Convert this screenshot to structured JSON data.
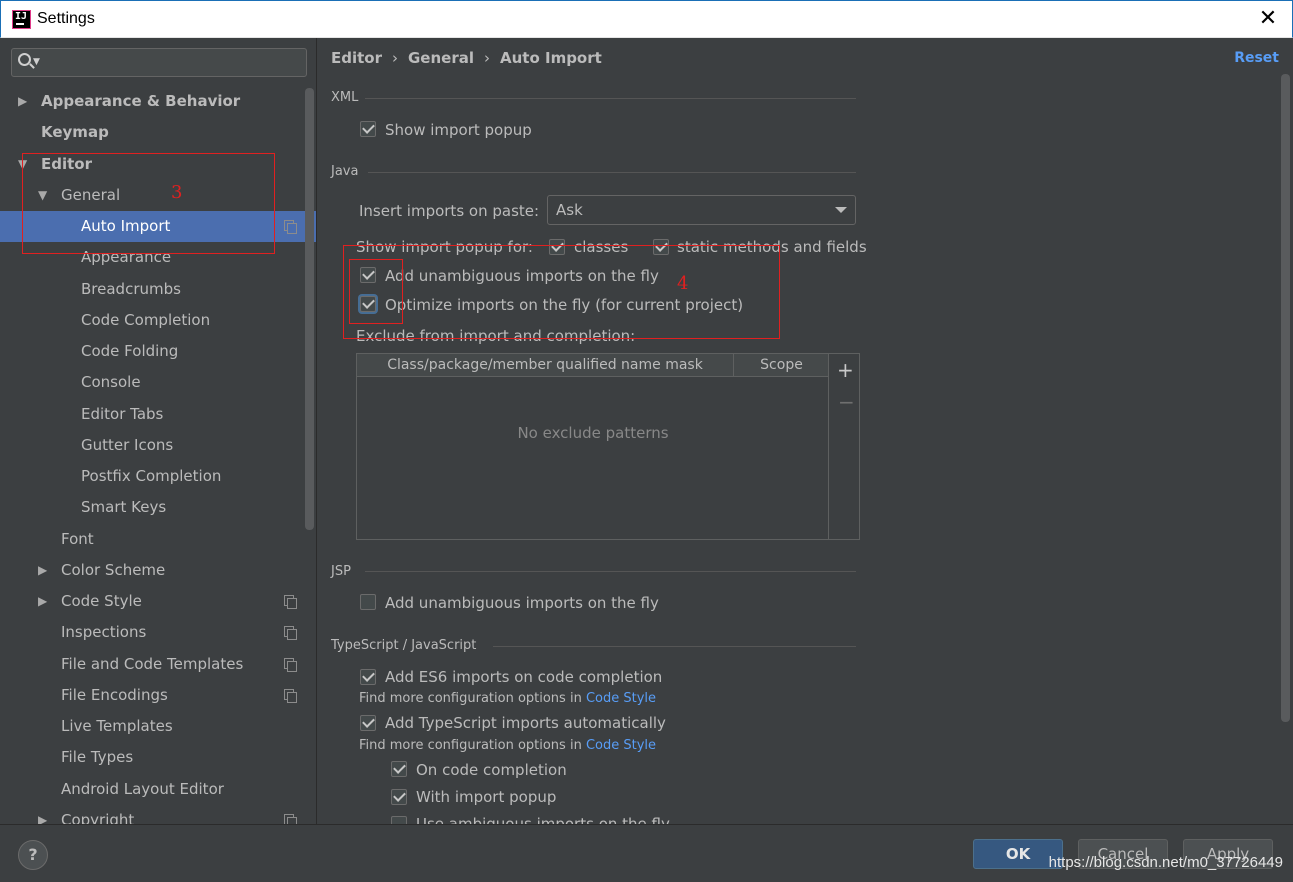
{
  "window": {
    "title": "Settings",
    "app_icon_text": "IJ"
  },
  "sidebar": {
    "search_value": "",
    "items": [
      {
        "label": "Appearance & Behavior"
      },
      {
        "label": "Keymap"
      },
      {
        "label": "Editor"
      },
      {
        "label": "General"
      },
      {
        "label": "Auto Import"
      },
      {
        "label": "Appearance"
      },
      {
        "label": "Breadcrumbs"
      },
      {
        "label": "Code Completion"
      },
      {
        "label": "Code Folding"
      },
      {
        "label": "Console"
      },
      {
        "label": "Editor Tabs"
      },
      {
        "label": "Gutter Icons"
      },
      {
        "label": "Postfix Completion"
      },
      {
        "label": "Smart Keys"
      },
      {
        "label": "Font"
      },
      {
        "label": "Color Scheme"
      },
      {
        "label": "Code Style"
      },
      {
        "label": "Inspections"
      },
      {
        "label": "File and Code Templates"
      },
      {
        "label": "File Encodings"
      },
      {
        "label": "Live Templates"
      },
      {
        "label": "File Types"
      },
      {
        "label": "Android Layout Editor"
      },
      {
        "label": "Copyright"
      }
    ]
  },
  "breadcrumb": {
    "p1": "Editor",
    "p2": "General",
    "p3": "Auto Import",
    "sep": "›"
  },
  "reset_label": "Reset",
  "xml": {
    "section": "XML",
    "show_import_popup": {
      "label": "Show import popup",
      "checked": true
    }
  },
  "java": {
    "section": "Java",
    "insert_on_paste_label": "Insert imports on paste:",
    "insert_on_paste_value": "Ask",
    "popup_for_label": "Show import popup for:",
    "classes": {
      "label": "classes",
      "checked": true
    },
    "static_methods": {
      "label": "static methods and fields",
      "checked": true
    },
    "add_unambiguous": {
      "label": "Add unambiguous imports on the fly",
      "checked": true
    },
    "optimize": {
      "label": "Optimize imports on the fly (for current project)",
      "checked": true
    },
    "exclude_label": "Exclude from import and completion:",
    "table": {
      "col1": "Class/package/member qualified name mask",
      "col2": "Scope",
      "empty": "No exclude patterns",
      "add": "+",
      "remove": "−"
    }
  },
  "jsp": {
    "section": "JSP",
    "add_unambiguous": {
      "label": "Add unambiguous imports on the fly",
      "checked": false
    }
  },
  "ts": {
    "section": "TypeScript / JavaScript",
    "es6": {
      "label": "Add ES6 imports on code completion",
      "checked": true
    },
    "note1": "Find more configuration options in",
    "link1": "Code Style",
    "ts_auto": {
      "label": "Add TypeScript imports automatically",
      "checked": true
    },
    "note2": "Find more configuration options in",
    "link2": "Code Style",
    "on_completion": {
      "label": "On code completion",
      "checked": true
    },
    "with_popup": {
      "label": "With import popup",
      "checked": true
    },
    "unambig_cut": {
      "label": "Use ambiguous imports on the fly",
      "checked": false
    }
  },
  "annotations": {
    "a3": "3",
    "a4": "4"
  },
  "footer": {
    "help": "?",
    "ok": "OK",
    "cancel": "Cancel",
    "apply": "Apply",
    "watermark": "https://blog.csdn.net/m0_37726449"
  },
  "colors": {
    "accent": "#4b6eaf",
    "link": "#589df6",
    "annotation": "#e02020",
    "background": "#3c3f41"
  }
}
